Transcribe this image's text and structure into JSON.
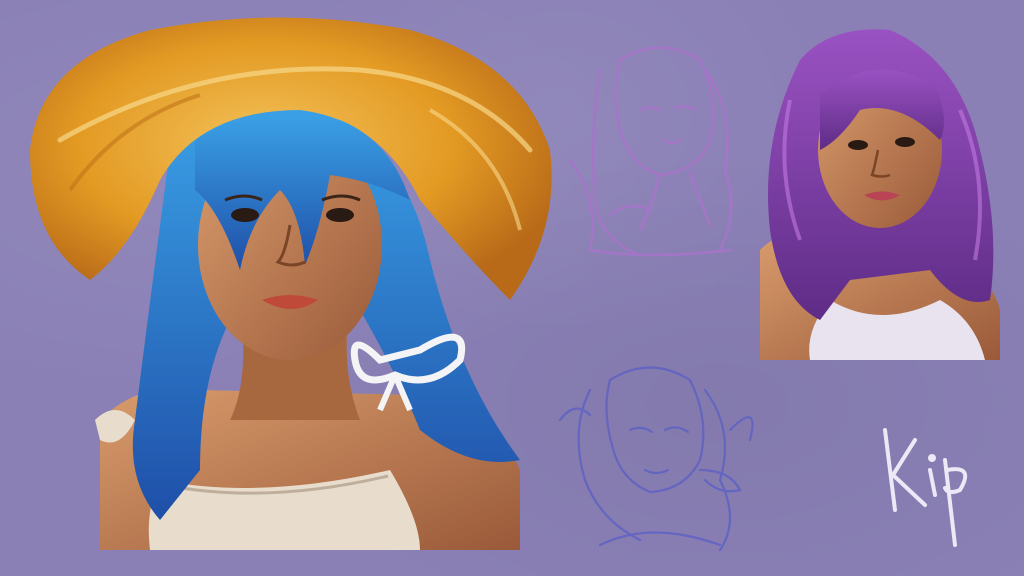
{
  "artwork": {
    "signature": "Kip",
    "palette": {
      "background": "#8a80b6",
      "hat": "#e8a12a",
      "blue_hair": "#2f7fc8",
      "purple_hair": "#7a3fa0",
      "skin": "#c98a5c",
      "sketch_pink": "#a874c9",
      "sketch_blue": "#5e62c4"
    }
  }
}
